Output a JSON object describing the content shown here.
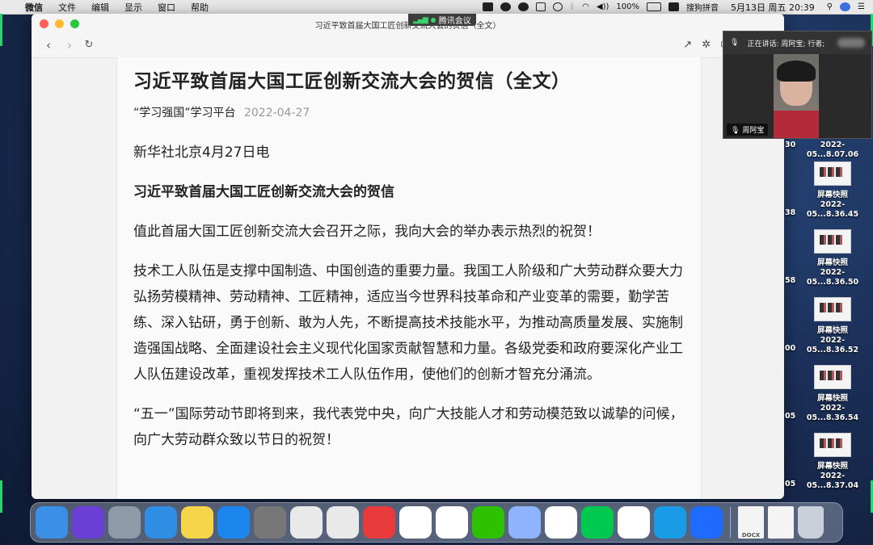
{
  "menubar": {
    "app": "微信",
    "menus": [
      "文件",
      "编辑",
      "显示",
      "窗口",
      "帮助"
    ],
    "battery": "100%",
    "input_method": "搜狗拼音",
    "datetime": "5月13日 周五  20:39"
  },
  "meeting_badge": "腾讯会议",
  "window": {
    "title": "习近平致首届大国工匠创新交流大会的贺信（全文）"
  },
  "article": {
    "headline": "习近平致首届大国工匠创新交流大会的贺信（全文）",
    "source": "“学习强国”学习平台",
    "date": "2022-04-27",
    "paragraphs": [
      "新华社北京4月27日电",
      "习近平致首届大国工匠创新交流大会的贺信",
      "值此首届大国工匠创新交流大会召开之际，我向大会的举办表示热烈的祝贺！",
      "技术工人队伍是支撑中国制造、中国创造的重要力量。我国工人阶级和广大劳动群众要大力弘扬劳模精神、劳动精神、工匠精神，适应当今世界科技革命和产业变革的需要，勤学苦练、深入钻研，勇于创新、敢为人先，不断提高技术技能水平，为推动高质量发展、实施制造强国战略、全面建设社会主义现代化国家贡献智慧和力量。各级党委和政府要深化产业工人队伍建设改革，重视发挥技术工人队伍作用，使他们的创新才智充分涌流。",
      "“五一”国际劳动节即将到来，我代表党中央，向广大技能人才和劳动模范致以诚挚的问候，向广大劳动群众致以节日的祝贺！"
    ]
  },
  "video": {
    "speaking": "正在讲话: 周阿宝; 行者;",
    "participant": "周阿宝"
  },
  "desktop": {
    "edge_numbers": [
      "30",
      "38",
      "58",
      "00",
      "05",
      "05"
    ],
    "items": [
      {
        "name": "",
        "time": "2022-05...8.07.06"
      },
      {
        "name": "屏幕快照",
        "time": "2022-05...8.36.45"
      },
      {
        "name": "屏幕快照",
        "time": "2022-05...8.36.50"
      },
      {
        "name": "屏幕快照",
        "time": "2022-05...8.36.52"
      },
      {
        "name": "屏幕快照",
        "time": "2022-05...8.36.54"
      },
      {
        "name": "屏幕快照",
        "time": "2022-05...8.37.04"
      }
    ]
  },
  "dock": {
    "apps": [
      {
        "name": "finder",
        "color": "#3b8fe6"
      },
      {
        "name": "siri",
        "color": "#6a3fd6"
      },
      {
        "name": "launchpad",
        "color": "#8f9aa8"
      },
      {
        "name": "safari",
        "color": "#2f8de4"
      },
      {
        "name": "notes",
        "color": "#f7d54a"
      },
      {
        "name": "app-store",
        "color": "#1c86ee"
      },
      {
        "name": "system-preferences",
        "color": "#777777"
      },
      {
        "name": "wps-presentation",
        "color": "#e9e9e9"
      },
      {
        "name": "wps-spreadsheet",
        "color": "#e9e9e9"
      },
      {
        "name": "netease-music",
        "color": "#e93b3b"
      },
      {
        "name": "wps-office",
        "color": "#ffffff"
      },
      {
        "name": "qq",
        "color": "#ffffff"
      },
      {
        "name": "wechat",
        "color": "#2dc100"
      },
      {
        "name": "feishu",
        "color": "#8fb4ff"
      },
      {
        "name": "tencent-video",
        "color": "#ffffff"
      },
      {
        "name": "iqiyi",
        "color": "#00c94f"
      },
      {
        "name": "baidu-netdisk",
        "color": "#ffffff"
      },
      {
        "name": "browser",
        "color": "#1a9be6"
      },
      {
        "name": "tencent-meeting",
        "color": "#1f6bff"
      }
    ],
    "docs": [
      {
        "name": "docx-file",
        "label": "DOCX"
      },
      {
        "name": "document-thumbnail",
        "label": ""
      },
      {
        "name": "trash",
        "label": ""
      }
    ]
  }
}
